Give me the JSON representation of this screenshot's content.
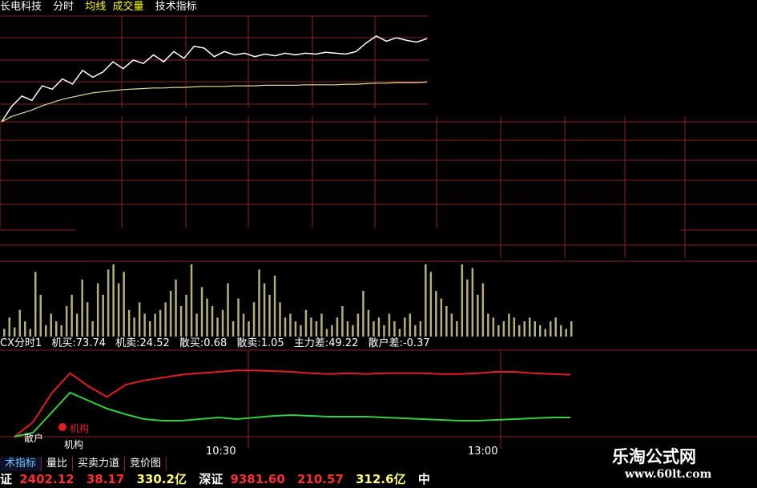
{
  "header": {
    "stock_name": "长电科技",
    "menu_fenshi": "分时",
    "menu_junxian": "均线",
    "menu_chengjiaoliang": "成交量",
    "menu_jishu": "技术指标"
  },
  "indicator": {
    "name": "CX分时1",
    "jimai_label": "机买:73.74",
    "jimai2_label": "机卖:24.52",
    "sanmai_label": "散买:0.68",
    "sanmai2_label": "散卖:1.05",
    "zhuli_label": "主力差:49.22",
    "sanhu_label": "散户差:-0.37",
    "legend_jigou": "机构",
    "legend_sanhu": "散户",
    "legend_jigou2": "机构"
  },
  "axis": {
    "time_1030": "10:30",
    "time_1300": "13:00"
  },
  "tabs": [
    "术指标",
    "量比",
    "买卖力道",
    "竞价图"
  ],
  "ticker": {
    "sh_label": "证",
    "sh_index": "2402.12",
    "sh_change": "38.17",
    "sh_amount": "330.2亿",
    "sz_label": "深证",
    "sz_index": "9381.60",
    "sz_change": "210.57",
    "sz_amount": "312.6亿",
    "extra": "中"
  },
  "watermark": {
    "title": "乐淘公式网",
    "url": "www.60lt.com"
  },
  "colors": {
    "grid": "#8a2222",
    "price": "#ffffff",
    "avg": "#e8d89a",
    "volume": "#b5b07a",
    "red_line": "#e02020",
    "green_line": "#30d040",
    "yellow": "#ffff00"
  },
  "chart_data": [
    {
      "type": "line",
      "series": [
        {
          "values": [
            0.0,
            0.18,
            0.3,
            0.25,
            0.42,
            0.38,
            0.5,
            0.44,
            0.6,
            0.52,
            0.58,
            0.7,
            0.62,
            0.72,
            0.68,
            0.78,
            0.7,
            0.82,
            0.74,
            0.88,
            0.86,
            0.76,
            0.82,
            0.78,
            0.8,
            0.76,
            0.79,
            0.77,
            0.8,
            0.78,
            0.8,
            0.79,
            0.81,
            0.8,
            0.79,
            0.82,
            0.92,
            1.0,
            0.94,
            0.98,
            0.95,
            0.93,
            0.97
          ]
        },
        {
          "values": [
            0.0,
            0.1,
            0.16,
            0.22,
            0.3,
            0.36,
            0.42,
            0.46,
            0.5,
            0.54,
            0.56,
            0.58,
            0.6,
            0.61,
            0.62,
            0.63,
            0.63,
            0.64,
            0.64,
            0.65,
            0.66,
            0.66,
            0.66,
            0.67,
            0.67,
            0.67,
            0.68,
            0.68,
            0.68,
            0.68,
            0.69,
            0.69,
            0.69,
            0.69,
            0.7,
            0.7,
            0.71,
            0.72,
            0.72,
            0.73,
            0.73,
            0.73,
            0.74
          ]
        }
      ]
    },
    {
      "type": "bar",
      "values": [
        0.1,
        0.25,
        0.12,
        0.35,
        0.2,
        0.1,
        0.85,
        0.55,
        0.15,
        0.3,
        0.2,
        0.15,
        0.4,
        0.55,
        0.3,
        0.75,
        0.45,
        0.2,
        0.7,
        0.55,
        0.88,
        0.95,
        0.7,
        0.85,
        0.35,
        0.25,
        0.45,
        0.3,
        0.2,
        0.3,
        0.35,
        0.45,
        0.6,
        0.75,
        0.4,
        0.55,
        0.95,
        0.3,
        0.65,
        0.5,
        0.4,
        0.25,
        0.35,
        0.7,
        0.2,
        0.5,
        0.3,
        0.2,
        0.45,
        0.88,
        0.7,
        0.55,
        0.8,
        0.45,
        0.25,
        0.3,
        0.2,
        0.15,
        0.35,
        0.25,
        0.2,
        0.3,
        0.1,
        0.15,
        0.25,
        0.4,
        0.2,
        0.15,
        0.3,
        0.6,
        0.35,
        0.2,
        0.25,
        0.15,
        0.3,
        0.2,
        0.1,
        0.25,
        0.3,
        0.15,
        0.2,
        0.95,
        0.85,
        0.6,
        0.5,
        0.4,
        0.3,
        0.2,
        0.95,
        0.75,
        0.9,
        0.55,
        0.7,
        0.3,
        0.25,
        0.15,
        0.2,
        0.3,
        0.25,
        0.15,
        0.2,
        0.25,
        0.2,
        0.15,
        0.1,
        0.2,
        0.25,
        0.15,
        0.1,
        0.2
      ]
    },
    {
      "type": "line",
      "series": [
        {
          "values": [
            0.0,
            0.2,
            0.6,
            0.88,
            0.7,
            0.55,
            0.72,
            0.78,
            0.82,
            0.86,
            0.88,
            0.9,
            0.92,
            0.92,
            0.91,
            0.9,
            0.88,
            0.87,
            0.88,
            0.87,
            0.88,
            0.88,
            0.88,
            0.87,
            0.87,
            0.88,
            0.9,
            0.9,
            0.88,
            0.87,
            0.86
          ]
        },
        {
          "values": [
            0.0,
            0.05,
            0.3,
            0.55,
            0.45,
            0.35,
            0.28,
            0.22,
            0.2,
            0.2,
            0.22,
            0.24,
            0.22,
            0.24,
            0.26,
            0.27,
            0.26,
            0.25,
            0.25,
            0.25,
            0.24,
            0.23,
            0.22,
            0.21,
            0.2,
            0.2,
            0.21,
            0.22,
            0.23,
            0.24,
            0.24
          ]
        }
      ]
    }
  ]
}
